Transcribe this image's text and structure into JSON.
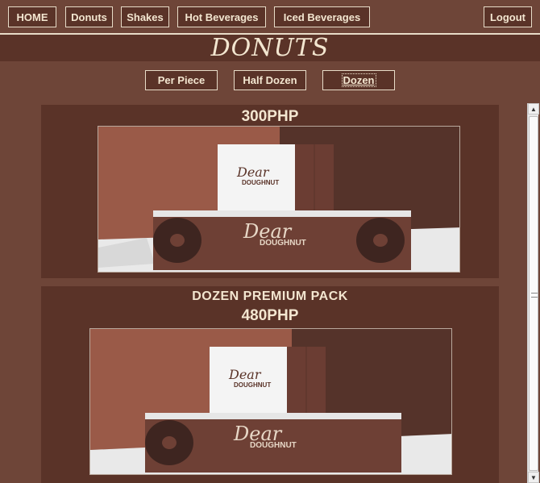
{
  "nav": {
    "home": "HOME",
    "donuts": "Donuts",
    "shakes": "Shakes",
    "hot_beverages": "Hot Beverages",
    "iced_beverages": "Iced Beverages",
    "logout": "Logout"
  },
  "page_title": "DONUTS",
  "filters": {
    "per_piece": "Per Piece",
    "half_dozen": "Half Dozen",
    "dozen": "Dozen",
    "selected": "Dozen"
  },
  "products": [
    {
      "price": "300PHP",
      "box_brand_top": "Dear",
      "box_brand_bottom": "DOUGHNUT"
    },
    {
      "name": "DOZEN PREMIUM PACK",
      "price": "480PHP",
      "box_brand_top": "Dear",
      "box_brand_bottom": "DOUGHNUT"
    }
  ],
  "colors": {
    "background": "#6e4538",
    "panel": "#5a3328",
    "text": "#f3e6d0",
    "border": "#e8dcc8"
  }
}
